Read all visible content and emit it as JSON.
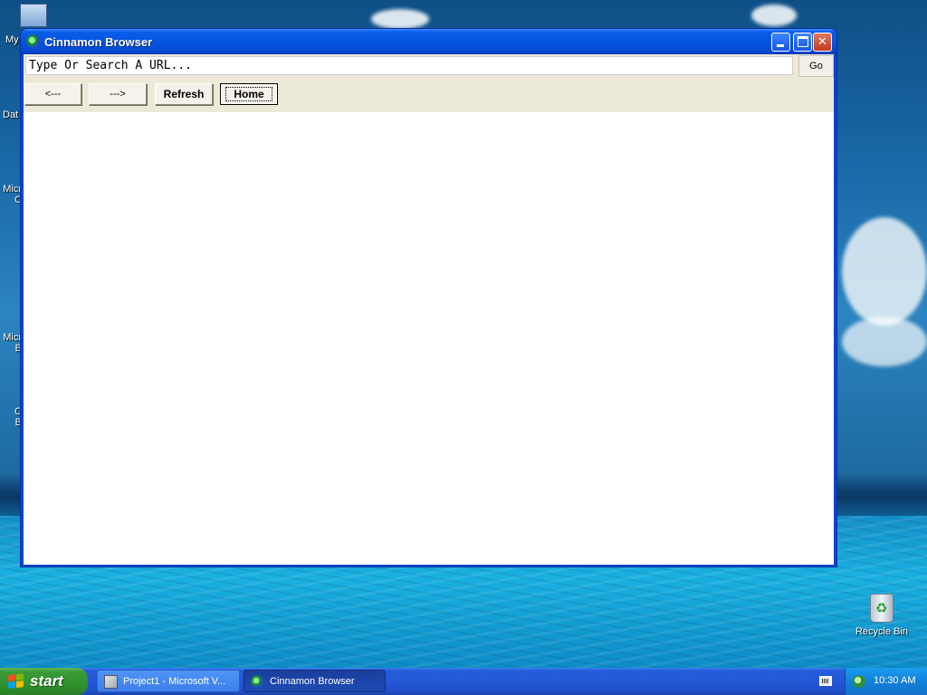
{
  "desktop": {
    "icons": [
      {
        "label": "My",
        "name": "my-computer"
      },
      {
        "label": "Dat",
        "name": "data"
      },
      {
        "label": "Micr\nC",
        "name": "microsoft-c"
      },
      {
        "label": "Micr\nB",
        "name": "microsoft-b"
      },
      {
        "label": "C\nB",
        "name": "c-b"
      }
    ],
    "recycle_bin_label": "Recycle Bin"
  },
  "window": {
    "title": "Cinnamon Browser",
    "minimize_icon": "minimize-icon",
    "maximize_icon": "maximize-icon",
    "close_glyph": "✕",
    "url_input": {
      "value": "Type Or Search A URL...",
      "placeholder": "Type Or Search A URL..."
    },
    "go_label": "Go",
    "toolbar": {
      "back_label": "<---",
      "forward_label": "--->",
      "refresh_label": "Refresh",
      "home_label": "Home"
    }
  },
  "taskbar": {
    "start_label": "start",
    "items": [
      {
        "label": "Project1 - Microsoft V...",
        "icon": "vb-project-icon",
        "active": false
      },
      {
        "label": "Cinnamon Browser",
        "icon": "globe-icon",
        "active": true
      }
    ],
    "clock": "10:30 AM"
  },
  "colors": {
    "titlebar": "#0554e3",
    "close_button": "#c53a1d",
    "start_button": "#3a9b39",
    "taskbar": "#2458d6",
    "tray": "#1380d9"
  }
}
